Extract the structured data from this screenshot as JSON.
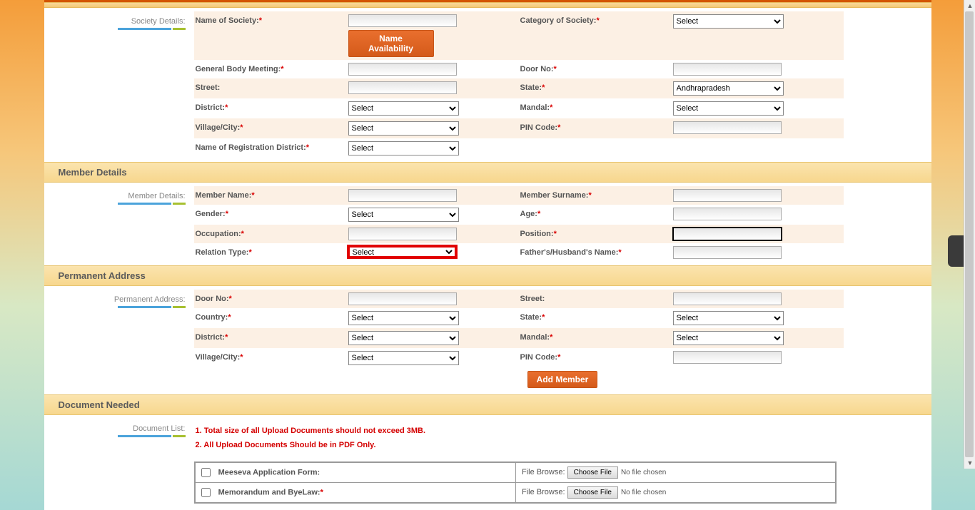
{
  "sections": {
    "society_details": {
      "side_label": "Society Details:",
      "fields": {
        "name_of_society": "Name of  Society:",
        "name_availability_btn": "Name Availability",
        "category_of_society": "Category of Society:",
        "general_body_meeting": "General Body Meeting:",
        "door_no": "Door No:",
        "street": "Street:",
        "state": "State:",
        "district": "District:",
        "mandal": "Mandal:",
        "village_city": "Village/City:",
        "pin_code": "PIN Code:",
        "name_of_reg_district": "Name of Registration District:"
      },
      "values": {
        "state_selected": "Andhrapradesh",
        "default_select": "Select"
      }
    },
    "member_details": {
      "header": "Member Details",
      "side_label": "Member Details:",
      "fields": {
        "member_name": "Member Name:",
        "member_surname": "Member Surname:",
        "gender": "Gender:",
        "age": "Age:",
        "occupation": "Occupation:",
        "position": "Position:",
        "relation_type": "Relation Type:",
        "fathers_husbands_name": "Father's/Husband's Name:"
      },
      "values": {
        "default_select": "Select"
      }
    },
    "permanent_address": {
      "header": "Permanent Address",
      "side_label": "Permanent Address:",
      "fields": {
        "door_no": "Door No:",
        "street": "Street:",
        "country": "Country:",
        "state": "State:",
        "district": "District:",
        "mandal": "Mandal:",
        "village_city": "Village/City:",
        "pin_code": "PIN Code:"
      },
      "values": {
        "default_select": "Select"
      },
      "add_member_btn": "Add Member"
    },
    "document_needed": {
      "header": "Document Needed",
      "side_label": "Document List:",
      "notes": {
        "line1": "1. Total size of all Upload Documents should not exceed 3MB.",
        "line2": "2. All Upload Documents Should be in PDF Only."
      },
      "rows": [
        {
          "label": "Meeseva Application Form:",
          "required": false
        },
        {
          "label": "Memorandum and ByeLaw:",
          "required": true
        }
      ],
      "file_browse_label": "File Browse:",
      "choose_file_btn": "Choose File",
      "no_file_text": "No file chosen"
    }
  }
}
